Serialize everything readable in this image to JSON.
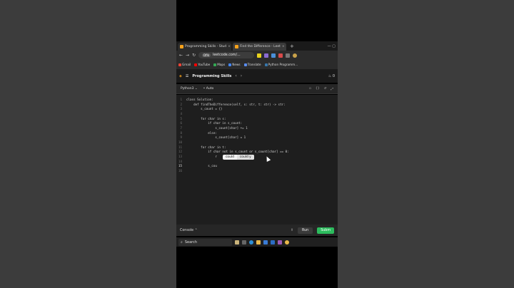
{
  "browser": {
    "tabs": [
      {
        "label": "Programming Skills - Stud",
        "active": false
      },
      {
        "label": "Find the Difference - Leet",
        "active": true
      }
    ],
    "new_tab": "+",
    "url": "leetcode.com/...",
    "url_badge": "Dflk",
    "bookmarks": [
      "Gmail",
      "YouTube",
      "Maps",
      "News",
      "Translate",
      "Python Programm..."
    ]
  },
  "leetcode": {
    "nav_title": "Programming Skills",
    "streak": "0",
    "language": "Python3",
    "auto": "Auto",
    "lines": [
      {
        "n": "1",
        "code": "class Solution:"
      },
      {
        "n": "2",
        "code": "    def findTheDifference(self, s: str, t: str) -> str:"
      },
      {
        "n": "3",
        "code": "        s_count = {}"
      },
      {
        "n": "4",
        "code": ""
      },
      {
        "n": "5",
        "code": "        for char in s:"
      },
      {
        "n": "6",
        "code": "            if char in s_count:"
      },
      {
        "n": "7",
        "code": "                s_count[char] += 1"
      },
      {
        "n": "8",
        "code": "            else:"
      },
      {
        "n": "9",
        "code": "                s_count[char] = 1"
      },
      {
        "n": "10",
        "code": ""
      },
      {
        "n": "11",
        "code": "        for char in t:"
      },
      {
        "n": "12",
        "code": "            if char not in s_count or s_count[char] == 0:"
      },
      {
        "n": "13",
        "code": "                r"
      },
      {
        "n": "14",
        "code": ""
      },
      {
        "n": "15",
        "code": "            s_cou"
      },
      {
        "n": "16",
        "code": ""
      }
    ],
    "current_line": "15",
    "autocomplete": [
      "could",
      "could y"
    ],
    "console": "Console",
    "run": "Run",
    "submit": "Subm"
  },
  "taskbar": {
    "search": "Search"
  },
  "colors": {
    "accent": "#2cbb5d",
    "editor_bg": "#1e1e1e"
  }
}
